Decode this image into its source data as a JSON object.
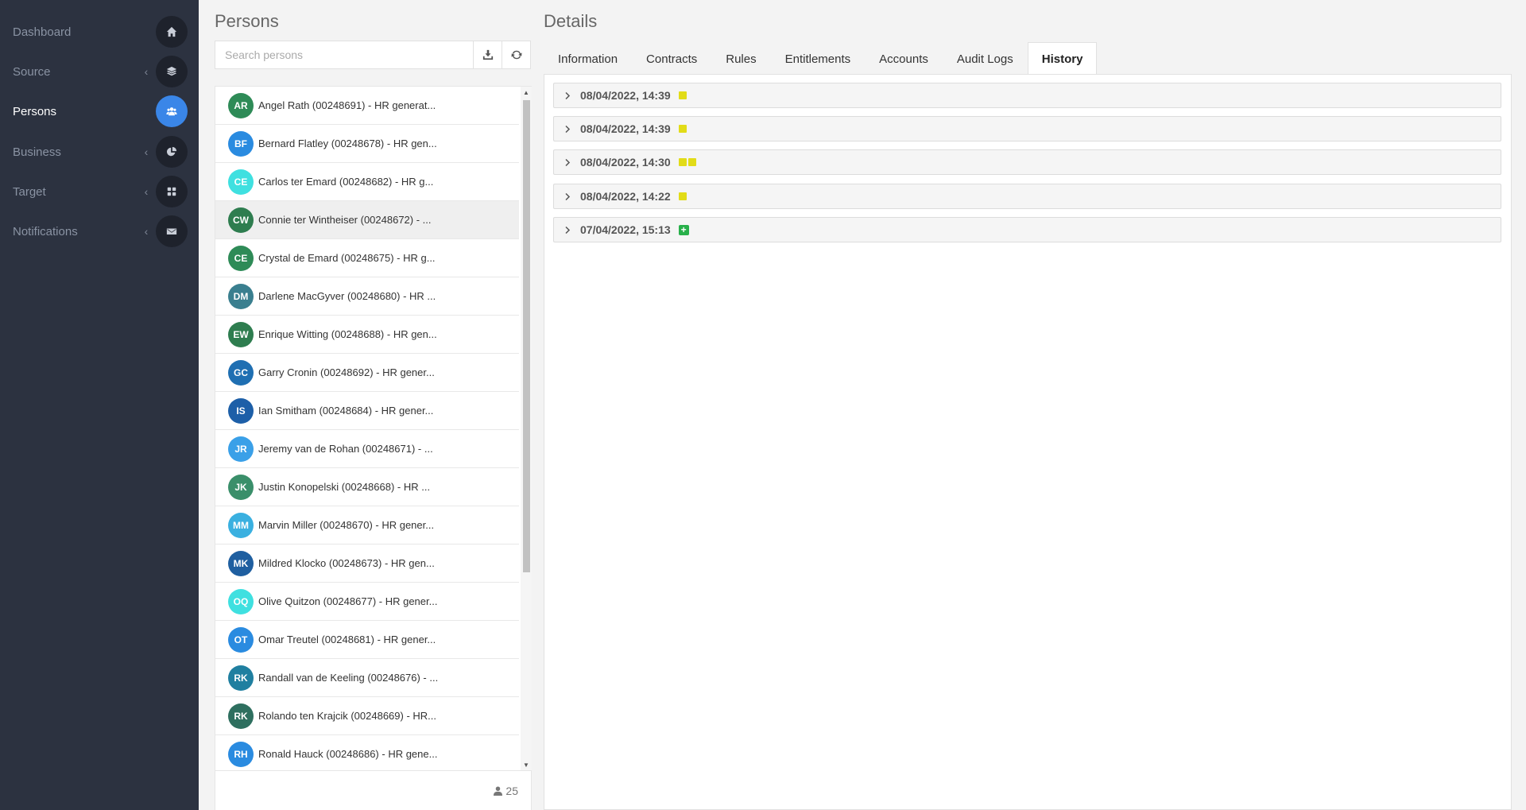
{
  "sidebar": {
    "items": [
      {
        "label": "Dashboard",
        "icon": "home-icon",
        "chevron": false,
        "active": false
      },
      {
        "label": "Source",
        "icon": "layers-icon",
        "chevron": true,
        "active": false
      },
      {
        "label": "Persons",
        "icon": "users-icon",
        "chevron": false,
        "active": true
      },
      {
        "label": "Business",
        "icon": "pie-chart-icon",
        "chevron": true,
        "active": false
      },
      {
        "label": "Target",
        "icon": "grid-icon",
        "chevron": true,
        "active": false
      },
      {
        "label": "Notifications",
        "icon": "envelope-icon",
        "chevron": true,
        "active": false
      }
    ]
  },
  "persons": {
    "title": "Persons",
    "search_placeholder": "Search persons",
    "search_value": "",
    "count": "25",
    "list": [
      {
        "initials": "AR",
        "name": "Angel Rath (00248691) - HR generat...",
        "color": "#2e8b57"
      },
      {
        "initials": "BF",
        "name": "Bernard Flatley (00248678) - HR gen...",
        "color": "#2a8be0"
      },
      {
        "initials": "CE",
        "name": "Carlos ter Emard (00248682) - HR g...",
        "color": "#3fe0e0"
      },
      {
        "initials": "CW",
        "name": "Connie ter Wintheiser (00248672) - ...",
        "color": "#2e7d4f",
        "selected": true
      },
      {
        "initials": "CE",
        "name": "Crystal de Emard (00248675) - HR g...",
        "color": "#2e8b57"
      },
      {
        "initials": "DM",
        "name": "Darlene MacGyver (00248680) - HR ...",
        "color": "#3a7f8f"
      },
      {
        "initials": "EW",
        "name": "Enrique Witting (00248688) - HR gen...",
        "color": "#2e7d4f"
      },
      {
        "initials": "GC",
        "name": "Garry Cronin (00248692) - HR gener...",
        "color": "#1f6fb2"
      },
      {
        "initials": "IS",
        "name": "Ian Smitham (00248684) - HR gener...",
        "color": "#1d5fa8"
      },
      {
        "initials": "JR",
        "name": "Jeremy van de Rohan (00248671) - ...",
        "color": "#3aa0e8"
      },
      {
        "initials": "JK",
        "name": "Justin Konopelski (00248668) - HR ...",
        "color": "#3a8f6a"
      },
      {
        "initials": "MM",
        "name": "Marvin Miller (00248670) - HR gener...",
        "color": "#3ab0e0"
      },
      {
        "initials": "MK",
        "name": "Mildred Klocko (00248673) - HR gen...",
        "color": "#1f5fa0"
      },
      {
        "initials": "OQ",
        "name": "Olive Quitzon (00248677) - HR gener...",
        "color": "#3fe0e0"
      },
      {
        "initials": "OT",
        "name": "Omar Treutel (00248681) - HR gener...",
        "color": "#2a8be0"
      },
      {
        "initials": "RK",
        "name": "Randall van de Keeling (00248676) - ...",
        "color": "#1f7fa0"
      },
      {
        "initials": "RK",
        "name": "Rolando ten Krajcik (00248669) - HR...",
        "color": "#2e6f5f"
      },
      {
        "initials": "RH",
        "name": "Ronald Hauck (00248686) - HR gene...",
        "color": "#2a8be0"
      }
    ]
  },
  "details": {
    "title": "Details",
    "tabs": [
      "Information",
      "Contracts",
      "Rules",
      "Entitlements",
      "Accounts",
      "Audit Logs",
      "History"
    ],
    "active_tab": "History",
    "history": [
      {
        "date": "08/04/2022, 14:39",
        "badges": [
          "change"
        ]
      },
      {
        "date": "08/04/2022, 14:39",
        "badges": [
          "change"
        ]
      },
      {
        "date": "08/04/2022, 14:30",
        "badges": [
          "change",
          "change"
        ]
      },
      {
        "date": "08/04/2022, 14:22",
        "badges": [
          "change"
        ]
      },
      {
        "date": "07/04/2022, 15:13",
        "badges": [
          "add"
        ]
      }
    ]
  },
  "colors": {
    "sidebar_bg": "#2c3240",
    "accent": "#3a86e8",
    "change_badge": "#e2dc18",
    "add_badge": "#28b04a"
  }
}
